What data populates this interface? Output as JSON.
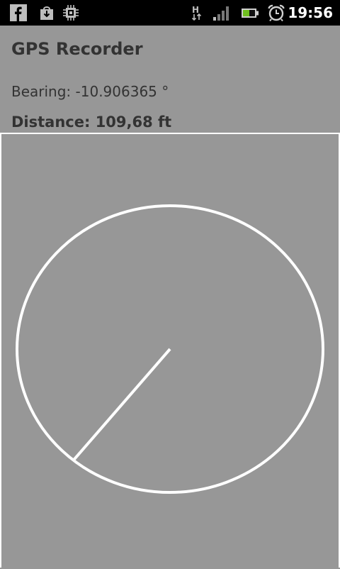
{
  "statusbar": {
    "time": "19:56",
    "network_type": "H",
    "notification_icons": [
      "facebook-icon",
      "download-icon",
      "chip-icon"
    ],
    "system_icons": [
      "network-h-icon",
      "signal-icon",
      "battery-icon",
      "alarm-icon"
    ]
  },
  "app": {
    "title": "GPS Recorder",
    "bearing_text": "Bearing: -10.906365 °",
    "distance_text": "Distance: 109,68 ft"
  },
  "colors": {
    "background": "#979797",
    "statusbar": "#000000",
    "text": "#333333",
    "compass_stroke": "#ffffff",
    "battery_level": "#6fbf1f"
  },
  "compass": {
    "needle_angle_deg": 229
  }
}
